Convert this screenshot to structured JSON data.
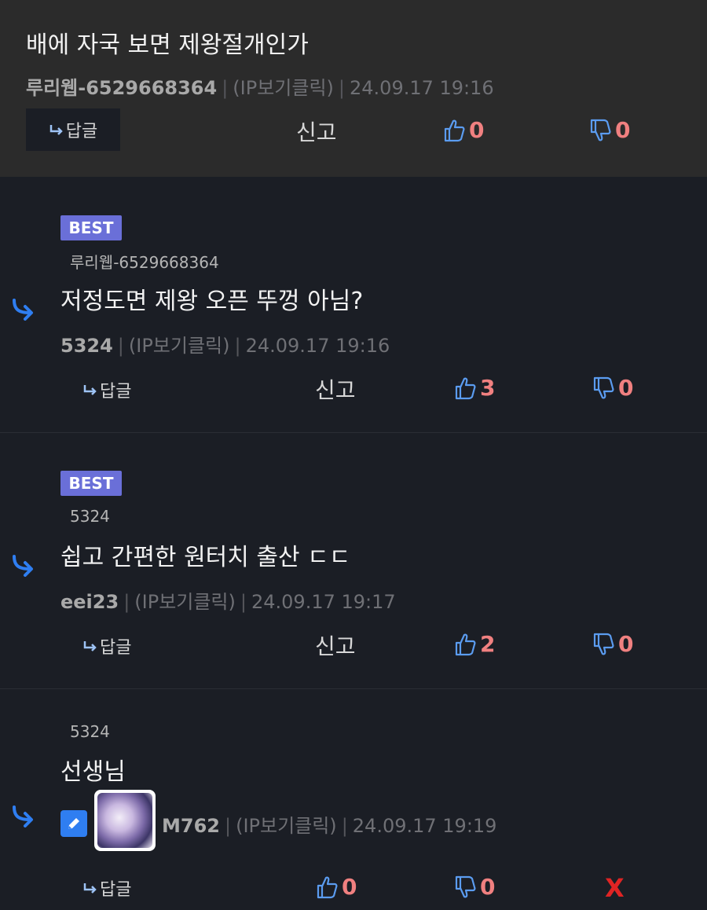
{
  "post": {
    "text": "배에 자국 보면 제왕절개인가",
    "author": "루리웹-6529668364",
    "ip_label": "(IP보기클릭)",
    "timestamp": "24.09.17 19:16",
    "reply_label": "답글",
    "report_label": "신고",
    "likes": "0",
    "dislikes": "0"
  },
  "comments": [
    {
      "badge": "BEST",
      "parent": "루리웹-6529668364",
      "text": "저정도면 제왕 오픈 뚜껑 아님?",
      "author": "5324",
      "ip_label": "(IP보기클릭)",
      "timestamp": "24.09.17 19:16",
      "reply_label": "답글",
      "report_label": "신고",
      "likes": "3",
      "dislikes": "0"
    },
    {
      "badge": "BEST",
      "parent": "5324",
      "text": "쉽고 간편한 원터치 출산 ㄷㄷ",
      "author": "eei23",
      "ip_label": "(IP보기클릭)",
      "timestamp": "24.09.17 19:17",
      "reply_label": "답글",
      "report_label": "신고",
      "likes": "2",
      "dislikes": "0"
    },
    {
      "parent": "5324",
      "text": "선생님",
      "author": "M762",
      "ip_label": "(IP보기클릭)",
      "timestamp": "24.09.17 19:19",
      "reply_label": "답글",
      "likes": "0",
      "dislikes": "0",
      "delete_label": "X"
    }
  ],
  "colors": {
    "accent_blue": "#2f7ef1",
    "badge": "#6a6fd8",
    "count_red": "#f08080",
    "delete_red": "#e02424"
  }
}
